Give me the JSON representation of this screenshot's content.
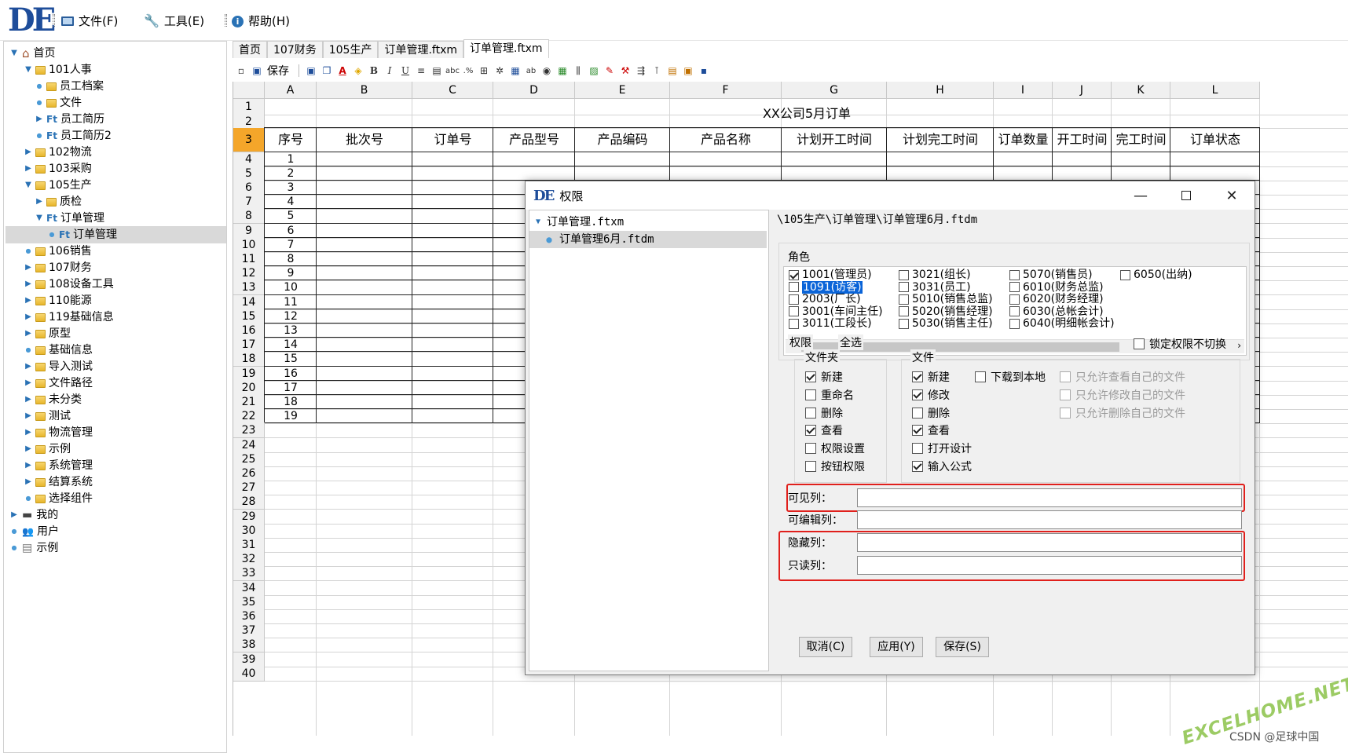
{
  "app": {
    "logo": "DE"
  },
  "menu": {
    "file": "文件(F)",
    "tools": "工具(E)",
    "help": "帮助(H)"
  },
  "tree": [
    {
      "label": "首页",
      "level": 0,
      "tw": "▼",
      "ic": "home"
    },
    {
      "label": "101人事",
      "level": 1,
      "tw": "▼",
      "ic": "folder"
    },
    {
      "label": "员工档案",
      "level": 2,
      "tw": "•",
      "ic": "folder"
    },
    {
      "label": "文件",
      "level": 2,
      "tw": "•",
      "ic": "folder"
    },
    {
      "label": "员工简历",
      "level": 2,
      "tw": "▶",
      "ic": "ft"
    },
    {
      "label": "员工简历2",
      "level": 2,
      "tw": "•",
      "ic": "ft"
    },
    {
      "label": "102物流",
      "level": 1,
      "tw": "▶",
      "ic": "folder"
    },
    {
      "label": "103采购",
      "level": 1,
      "tw": "▶",
      "ic": "folder"
    },
    {
      "label": "105生产",
      "level": 1,
      "tw": "▼",
      "ic": "folder"
    },
    {
      "label": "质检",
      "level": 2,
      "tw": "▶",
      "ic": "folder"
    },
    {
      "label": "订单管理",
      "level": 2,
      "tw": "▼",
      "ic": "ft"
    },
    {
      "label": "订单管理",
      "level": 3,
      "tw": "•",
      "ic": "ft",
      "sel": true
    },
    {
      "label": "106销售",
      "level": 1,
      "tw": "•",
      "ic": "folder"
    },
    {
      "label": "107财务",
      "level": 1,
      "tw": "▶",
      "ic": "folder"
    },
    {
      "label": "108设备工具",
      "level": 1,
      "tw": "▶",
      "ic": "folder"
    },
    {
      "label": "110能源",
      "level": 1,
      "tw": "▶",
      "ic": "folder"
    },
    {
      "label": "119基础信息",
      "level": 1,
      "tw": "▶",
      "ic": "folder"
    },
    {
      "label": "原型",
      "level": 1,
      "tw": "▶",
      "ic": "folder"
    },
    {
      "label": "基础信息",
      "level": 1,
      "tw": "•",
      "ic": "folder"
    },
    {
      "label": "导入测试",
      "level": 1,
      "tw": "▶",
      "ic": "folder"
    },
    {
      "label": "文件路径",
      "level": 1,
      "tw": "▶",
      "ic": "folder"
    },
    {
      "label": "未分类",
      "level": 1,
      "tw": "▶",
      "ic": "folder"
    },
    {
      "label": "测试",
      "level": 1,
      "tw": "▶",
      "ic": "folder"
    },
    {
      "label": "物流管理",
      "level": 1,
      "tw": "▶",
      "ic": "folder"
    },
    {
      "label": "示例",
      "level": 1,
      "tw": "▶",
      "ic": "folder"
    },
    {
      "label": "系统管理",
      "level": 1,
      "tw": "▶",
      "ic": "folder"
    },
    {
      "label": "结算系统",
      "level": 1,
      "tw": "▶",
      "ic": "folder"
    },
    {
      "label": "选择组件",
      "level": 1,
      "tw": "•",
      "ic": "folder"
    },
    {
      "label": "我的",
      "level": 0,
      "tw": "▶",
      "ic": "pc"
    },
    {
      "label": "用户",
      "level": 0,
      "tw": "•",
      "ic": "user"
    },
    {
      "label": "示例",
      "level": 0,
      "tw": "•",
      "ic": "doc"
    }
  ],
  "tabs": [
    "首页",
    "107财务",
    "105生产",
    "订单管理.ftxm",
    "订单管理.ftxm"
  ],
  "toolbar": {
    "save": "保存"
  },
  "sheet": {
    "columns": [
      "A",
      "B",
      "C",
      "D",
      "E",
      "F",
      "G",
      "H",
      "I",
      "J",
      "K",
      "L"
    ],
    "title": "XX公司5月订单",
    "headers": [
      "序号",
      "批次号",
      "订单号",
      "产品型号",
      "产品编码",
      "产品名称",
      "计划开工时间",
      "计划完工时间",
      "订单数量",
      "开工时间",
      "完工时间",
      "订单状态"
    ],
    "rows": [
      "1",
      "2",
      "3",
      "4",
      "5",
      "6",
      "7",
      "8",
      "9",
      "10",
      "11",
      "12",
      "13",
      "14",
      "15",
      "16",
      "17",
      "18",
      "19",
      "20",
      "21",
      "22",
      "23",
      "24",
      "25",
      "26",
      "27",
      "28",
      "29",
      "30",
      "31",
      "32",
      "33",
      "34",
      "35",
      "36",
      "37",
      "38",
      "39",
      "40"
    ],
    "seq": [
      "1",
      "2",
      "3",
      "4",
      "5",
      "6",
      "7",
      "8",
      "9",
      "10",
      "11",
      "12",
      "13",
      "14",
      "15",
      "16",
      "17",
      "18",
      "19"
    ]
  },
  "dialog": {
    "title": "权限",
    "tree_root": "订单管理.ftxm",
    "tree_child": "订单管理6月.ftdm",
    "path": "\\105生产\\订单管理\\订单管理6月.ftdm",
    "roles_label": "角色",
    "roles": [
      {
        "label": "1001(管理员)",
        "checked": true
      },
      {
        "label": "1091(访客)",
        "checked": false,
        "highlight": true
      },
      {
        "label": "2003(厂长)",
        "checked": false
      },
      {
        "label": "3001(车间主任)",
        "checked": false
      },
      {
        "label": "3011(工段长)",
        "checked": false
      },
      {
        "label": "3021(组长)",
        "checked": false
      },
      {
        "label": "3031(员工)",
        "checked": false
      },
      {
        "label": "5010(销售总监)",
        "checked": false
      },
      {
        "label": "5020(销售经理)",
        "checked": false
      },
      {
        "label": "5030(销售主任)",
        "checked": false
      },
      {
        "label": "5070(销售员)",
        "checked": false
      },
      {
        "label": "6010(财务总监)",
        "checked": false
      },
      {
        "label": "6020(财务经理)",
        "checked": false
      },
      {
        "label": "6030(总帐会计)",
        "checked": false
      },
      {
        "label": "6040(明细帐会计)",
        "checked": false
      },
      {
        "label": "6050(出纳)",
        "checked": false
      }
    ],
    "perm_label": "权限",
    "select_all": "全选",
    "lock_label": "锁定权限不切换",
    "folder_group": "文件夹",
    "folder_items": [
      {
        "label": "新建",
        "checked": true
      },
      {
        "label": "重命名",
        "checked": false
      },
      {
        "label": "删除",
        "checked": false
      },
      {
        "label": "查看",
        "checked": true
      },
      {
        "label": "权限设置",
        "checked": false
      },
      {
        "label": "按钮权限",
        "checked": false
      }
    ],
    "file_group": "文件",
    "file_items": [
      {
        "label": "新建",
        "checked": true
      },
      {
        "label": "修改",
        "checked": true
      },
      {
        "label": "删除",
        "checked": false
      },
      {
        "label": "查看",
        "checked": true
      },
      {
        "label": "打开设计",
        "checked": false
      },
      {
        "label": "输入公式",
        "checked": true
      }
    ],
    "download_label": "下载到本地",
    "restrict_items": [
      "只允许查看自己的文件",
      "只允许修改自己的文件",
      "只允许删除自己的文件"
    ],
    "fields": [
      {
        "label": "可见列：",
        "value": ""
      },
      {
        "label": "可编辑列：",
        "value": ""
      },
      {
        "label": "隐藏列：",
        "value": ""
      },
      {
        "label": "只读列：",
        "value": ""
      }
    ],
    "buttons": {
      "cancel": "取消(C)",
      "apply": "应用(Y)",
      "save": "保存(S)"
    }
  },
  "watermark": "EXCELHOME.NET",
  "credit": "CSDN @足球中国",
  "colors": {
    "accent": "#f4a62a",
    "highlight": "#e0201c",
    "brand": "#1e4d9a"
  }
}
